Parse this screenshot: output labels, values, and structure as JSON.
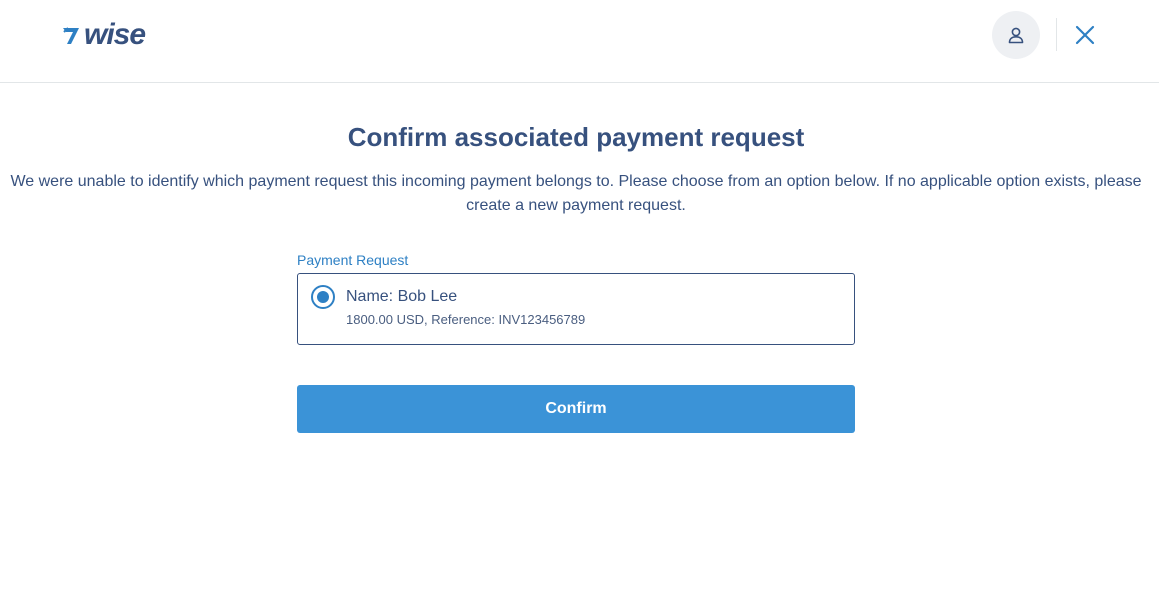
{
  "header": {
    "logo_text": "wise",
    "logo_icon": "wise-flag-icon",
    "account_icon": "user-icon",
    "close_icon": "close-icon",
    "colors": {
      "brand_navy": "#37517e",
      "accent_blue": "#2e80c4",
      "button_blue": "#3b93d7"
    }
  },
  "main": {
    "title": "Confirm associated payment request",
    "description": "We were unable to identify which payment request this incoming payment belongs to. Please choose from an option below. If no applicable option exists, please create a new payment request.",
    "field_label": "Payment Request",
    "options": [
      {
        "selected": true,
        "name": "Name: Bob Lee",
        "detail": "1800.00 USD, Reference: INV123456789"
      }
    ],
    "confirm_label": "Confirm"
  }
}
